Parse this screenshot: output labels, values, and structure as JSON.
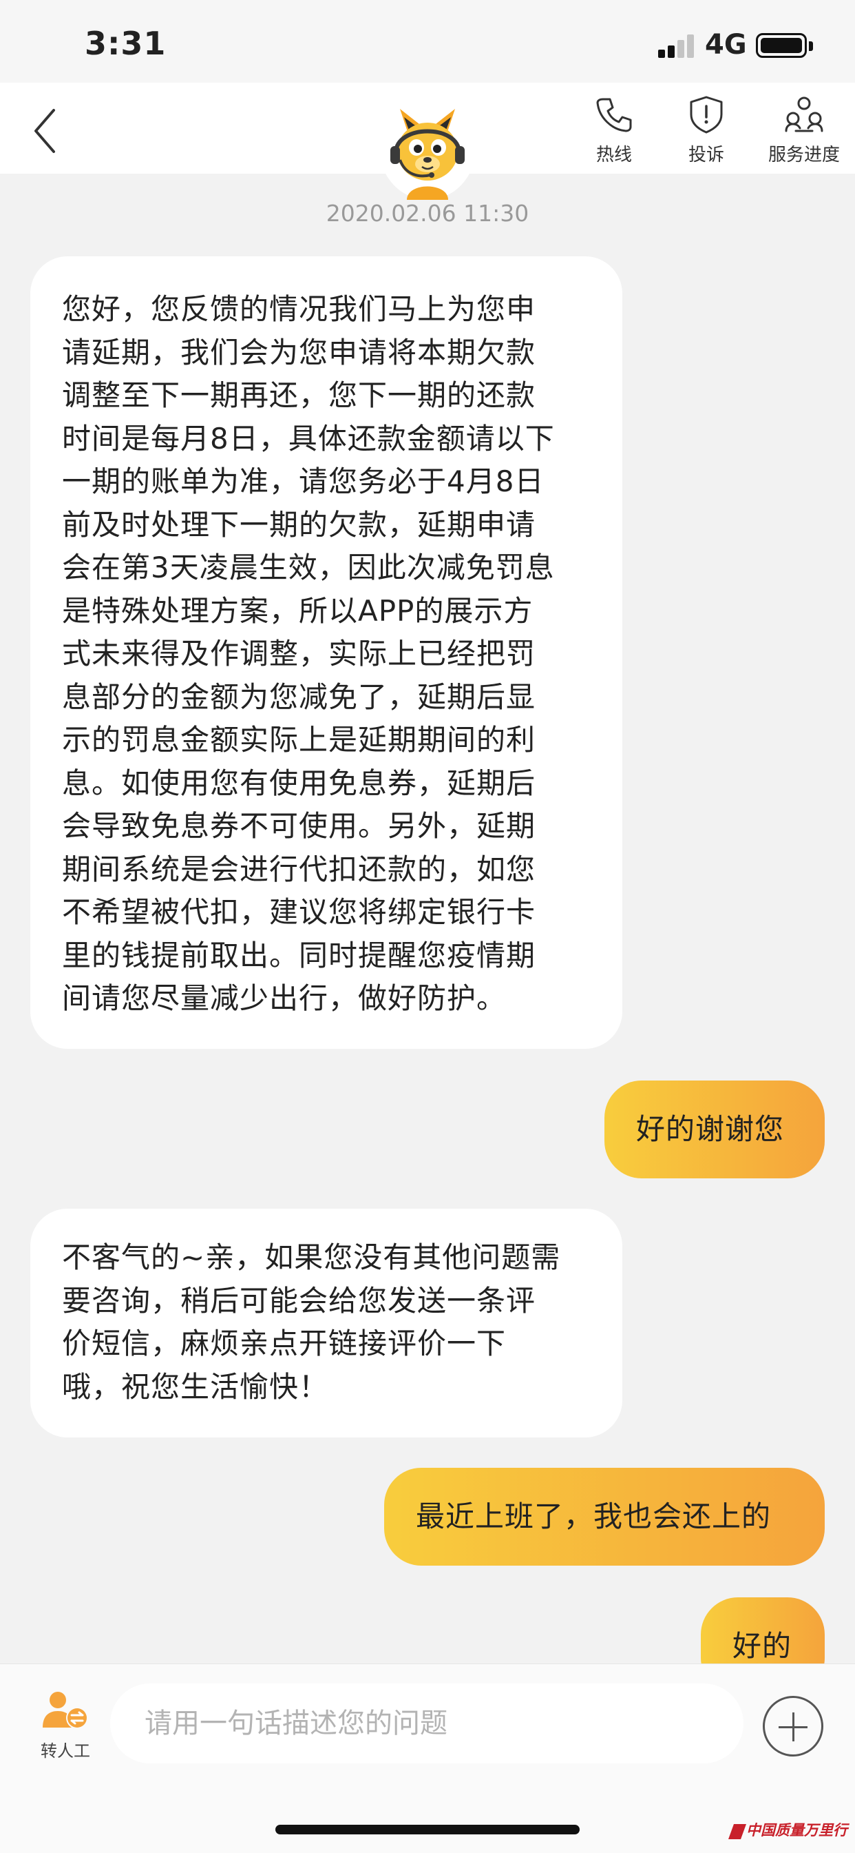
{
  "status_bar": {
    "time": "3:31",
    "network": "4G"
  },
  "nav": {
    "actions": [
      {
        "label": "热线",
        "icon": "phone-icon"
      },
      {
        "label": "投诉",
        "icon": "shield-alert-icon"
      },
      {
        "label": "服务进度",
        "icon": "progress-people-icon"
      }
    ],
    "avatar_icon": "kangaroo-agent-icon"
  },
  "chat": {
    "timestamp": "2020.02.06 11:30",
    "messages": [
      {
        "side": "in",
        "lines": [
          "您好，您反馈的情况我们马上为您申",
          "请延期，我们会为您申请将本期欠款",
          "调整至下一期再还，您下一期的还款",
          "时间是每月8日，具体还款金额请以下",
          "一期的账单为准，请您务必于4月8日",
          "前及时处理下一期的欠款，延期申请",
          "会在第3天凌晨生效，因此次减免罚息",
          "是特殊处理方案，所以APP的展示方",
          "式未来得及作调整，实际上已经把罚",
          "息部分的金额为您减免了，延期后显",
          "示的罚息金额实际上是延期期间的利",
          "息。如使用您有使用免息券，延期后",
          "会导致免息券不可使用。另外，延期",
          "期间系统是会进行代扣还款的，如您",
          "不希望被代扣，建议您将绑定银行卡",
          "里的钱提前取出。同时提醒您疫情期",
          "间请您尽量减少出行，做好防护。"
        ]
      },
      {
        "side": "out",
        "lines": [
          "好的谢谢您"
        ]
      },
      {
        "side": "in",
        "lines": [
          "不客气的~亲，如果您没有其他问题需",
          "要咨询，稍后可能会给您发送一条评",
          "价短信，麻烦亲点开链接评价一下",
          "哦，祝您生活愉快！"
        ]
      },
      {
        "side": "out",
        "lines": [
          "最近上班了，我也会还上的"
        ]
      },
      {
        "side": "out",
        "lines": [
          "好的"
        ]
      }
    ]
  },
  "input_bar": {
    "transfer_label": "转人工",
    "transfer_icon": "person-transfer-icon",
    "placeholder": "请用一句话描述您的问题",
    "add_icon": "plus-circle-icon"
  },
  "watermark": {
    "text": "中国质量万里行"
  },
  "colors": {
    "accent_start": "#f8cd3d",
    "accent_end": "#f5a43c",
    "icon_orange": "#f5a43c"
  }
}
